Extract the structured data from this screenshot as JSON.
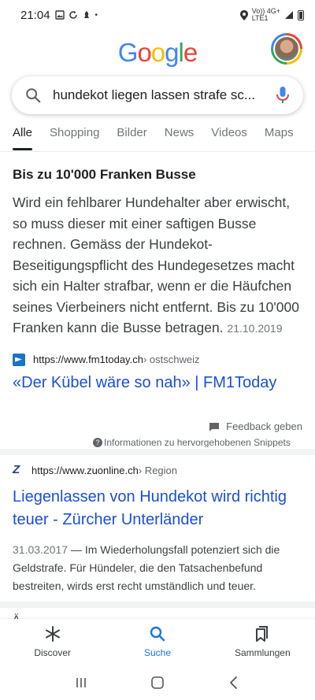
{
  "status_bar": {
    "time": "21:04",
    "network_text": "Vo)) 4G+",
    "network_sub": "LTE1",
    "battery_level": 0.75
  },
  "header": {
    "logo_text": "Google",
    "logo_colors": [
      "#4285f4",
      "#ea4335",
      "#fbbc05",
      "#4285f4",
      "#34a853",
      "#ea4335"
    ]
  },
  "search": {
    "query": "hundekot liegen lassen strafe sc...",
    "search_icon": "search-icon",
    "mic_icon": "mic-icon"
  },
  "tabs": [
    {
      "label": "Alle",
      "active": true
    },
    {
      "label": "Shopping",
      "active": false
    },
    {
      "label": "Bilder",
      "active": false
    },
    {
      "label": "News",
      "active": false
    },
    {
      "label": "Videos",
      "active": false
    },
    {
      "label": "Maps",
      "active": false
    }
  ],
  "featured_snippet": {
    "title": "Bis zu 10'000 Franken Busse",
    "body": "Wird ein fehlbarer Hundehalter aber erwischt, so muss dieser mit einer saftigen Busse rechnen. Gemäss der Hundekot-Beseitigungspflicht des Hundegesetzes macht sich ein Halter strafbar, wenn er die Häufchen seines Vierbeiners nicht entfernt. Bis zu 10'000 Franken kann die Busse betragen.",
    "date": "21.10.2019",
    "source_url": "https://www.fm1today.ch",
    "source_path": " › ostschweiz",
    "link_title": "«Der Kübel wäre so nah» | FM1Today",
    "feedback_label": "Feedback geben",
    "info_label": "Informationen zu hervorgehobenen Snippets"
  },
  "result2": {
    "source_url": "https://www.zuonline.ch",
    "source_path": " › Region",
    "title": "Liegenlassen von Hundekot wird richtig teuer - Zürcher Unterländer",
    "date": "31.03.2017",
    "description": " — Im Wiederholungsfall potenziert sich die Geldstrafe. Für Hündeler, die den Tatsachenbefund bestreiten, wirds erst recht umständlich und teuer."
  },
  "partial_next": "Ä",
  "bottom_nav": [
    {
      "label": "Discover",
      "icon": "asterisk-icon",
      "active": false
    },
    {
      "label": "Suche",
      "icon": "search-icon",
      "active": true
    },
    {
      "label": "Sammlungen",
      "icon": "bookmarks-icon",
      "active": false
    }
  ],
  "colors": {
    "link": "#1a4fd6",
    "active_tab": "#202124",
    "active_nav": "#1a73e8",
    "separator": "#f1f3f4"
  }
}
